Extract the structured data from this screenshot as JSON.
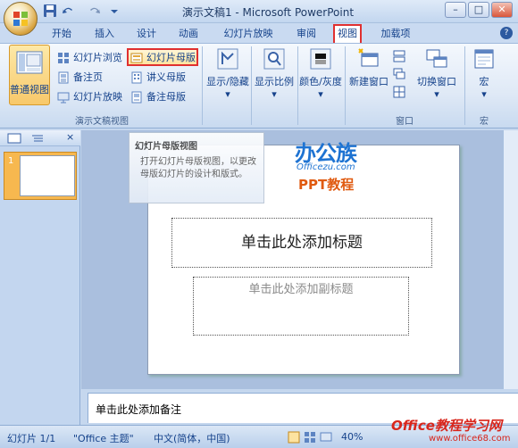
{
  "window": {
    "title": "演示文稿1 - Microsoft PowerPoint",
    "min": "–",
    "max": "□",
    "close": "✕"
  },
  "tabs": [
    {
      "label": "开始"
    },
    {
      "label": "插入"
    },
    {
      "label": "设计"
    },
    {
      "label": "动画"
    },
    {
      "label": "幻灯片放映"
    },
    {
      "label": "审阅"
    },
    {
      "label": "视图"
    },
    {
      "label": "加载项"
    }
  ],
  "help_label": "?",
  "ribbon": {
    "presentation_views": {
      "normal": "普通视图",
      "slide_sorter": "幻灯片浏览",
      "notes_page": "备注页",
      "slide_show": "幻灯片放映",
      "slide_master": "幻灯片母版",
      "handout_master": "讲义母版",
      "notes_master": "备注母版",
      "group_label": "演示文稿视图"
    },
    "show_hide": "显示/隐藏",
    "zoom": "显示比例",
    "color": "颜色/灰度",
    "window_group": {
      "new_window": "新建窗口",
      "switch_windows": "切换窗口",
      "group_label": "窗口"
    },
    "macros": {
      "label": "宏",
      "group_label": "宏"
    },
    "dropdown_arrow": "▾"
  },
  "tooltip": {
    "title": "幻灯片母版视图",
    "body": "打开幻灯片母版视图，以更改母版幻灯片的设计和版式。"
  },
  "slide_pane": {
    "slide_number": "1"
  },
  "slide": {
    "title_placeholder": "单击此处添加标题",
    "subtitle_placeholder": "单击此处添加副标题"
  },
  "notes_placeholder": "单击此处添加备注",
  "watermarks": {
    "site1": "办公族",
    "site1_url": "Officezu.com",
    "site1_sub": "PPT教程",
    "site2": "Office教程学习网",
    "site2_url": "www.office68.com"
  },
  "status": {
    "slide": "幻灯片 1/1",
    "theme": "\"Office 主题\"",
    "language": "中文(简体，中国)",
    "zoom": "40%"
  }
}
